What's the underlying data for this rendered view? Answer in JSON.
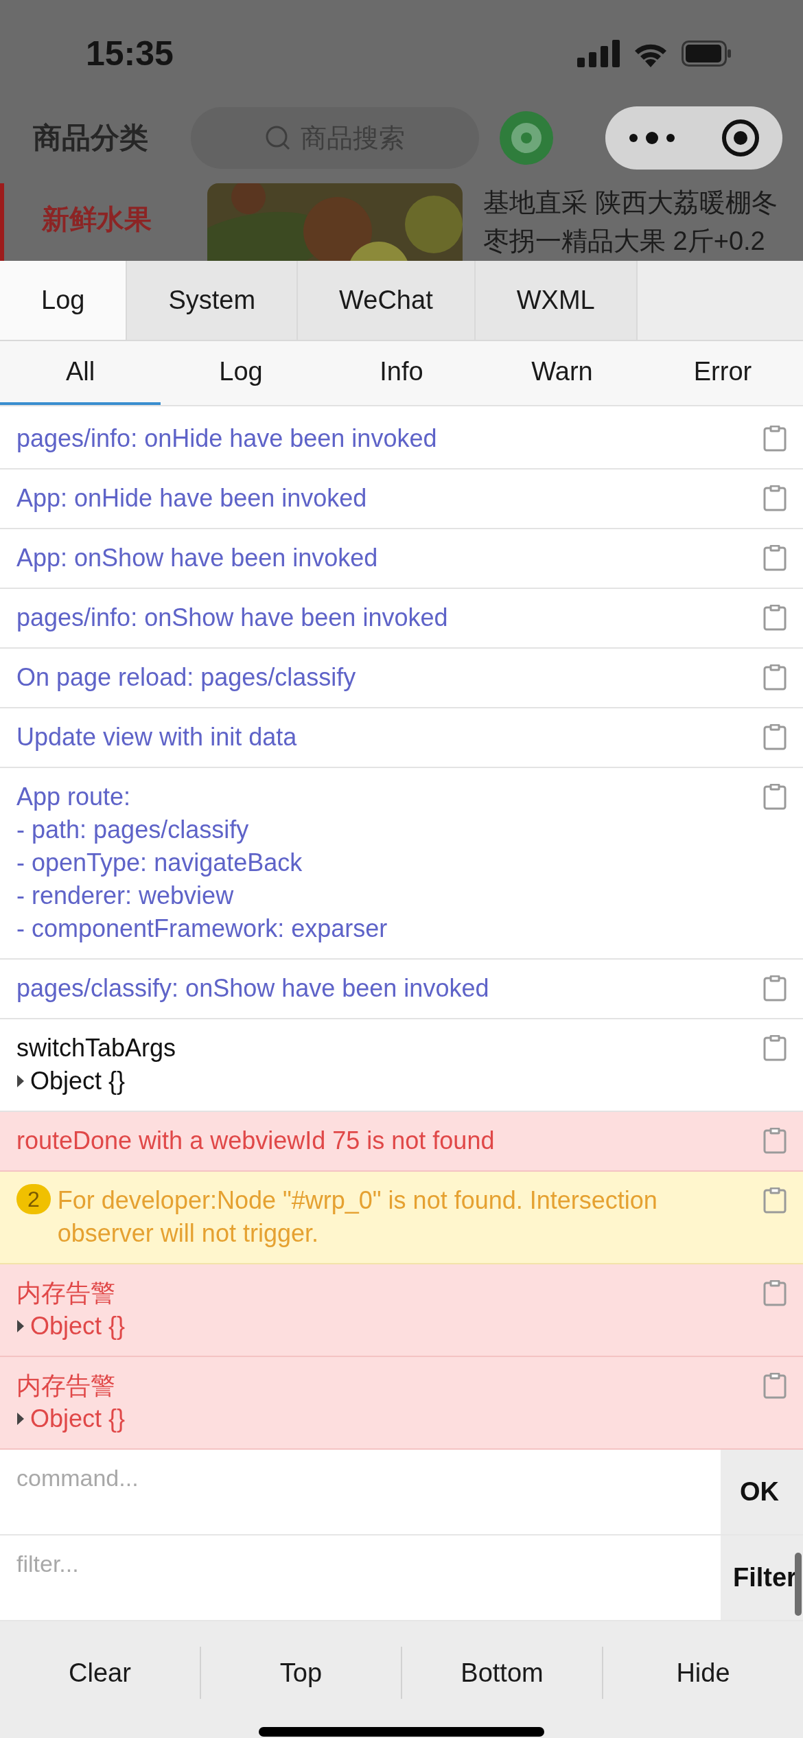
{
  "status_bar": {
    "time": "15:35"
  },
  "nav": {
    "title": "商品分类",
    "search": {
      "placeholder": "商品搜索"
    }
  },
  "category": {
    "label": "新鲜水果",
    "selected": true
  },
  "product": {
    "kind": "picture",
    "title_lines": [
      "基地直采 陕西大荔暖棚冬",
      "枣拐一精品大果 2斤+0.2"
    ]
  },
  "panel_tabs": [
    {
      "label": "Log",
      "selected": true
    },
    {
      "label": "System",
      "selected": false
    },
    {
      "label": "WeChat",
      "selected": false
    },
    {
      "label": "WXML",
      "selected": false
    }
  ],
  "level_tabs": [
    {
      "label": "All",
      "selected": true
    },
    {
      "label": "Log",
      "selected": false
    },
    {
      "label": "Info",
      "selected": false
    },
    {
      "label": "Warn",
      "selected": false
    },
    {
      "label": "Error",
      "selected": false
    }
  ],
  "entries": [
    {
      "kind": "info",
      "lines": [
        {
          "kind": "text",
          "text": "pages/info: onHide have been invoked"
        }
      ]
    },
    {
      "kind": "info",
      "lines": [
        {
          "kind": "text",
          "text": "App: onHide have been invoked"
        }
      ]
    },
    {
      "kind": "info",
      "lines": [
        {
          "kind": "text",
          "text": "App: onShow have been invoked"
        }
      ]
    },
    {
      "kind": "info",
      "lines": [
        {
          "kind": "text",
          "text": "pages/info: onShow have been invoked"
        }
      ]
    },
    {
      "kind": "info",
      "lines": [
        {
          "kind": "text",
          "text": "On page reload: pages/classify"
        }
      ]
    },
    {
      "kind": "info",
      "lines": [
        {
          "kind": "text",
          "text": "Update view with init data"
        }
      ]
    },
    {
      "kind": "info",
      "lines": [
        {
          "kind": "text",
          "text": "App route:"
        },
        {
          "kind": "text",
          "text": "- path: pages/classify"
        },
        {
          "kind": "text",
          "text": "- openType: navigateBack"
        },
        {
          "kind": "text",
          "text": "- renderer: webview"
        },
        {
          "kind": "text",
          "text": "- componentFramework: exparser"
        }
      ]
    },
    {
      "kind": "info",
      "lines": [
        {
          "kind": "text",
          "text": "pages/classify: onShow have been invoked"
        }
      ]
    },
    {
      "kind": "log",
      "lines": [
        {
          "kind": "text",
          "text": "switchTabArgs"
        },
        {
          "kind": "object",
          "text": "Object {}"
        }
      ]
    },
    {
      "kind": "error",
      "lines": [
        {
          "kind": "text",
          "text": "routeDone with a webviewId 75 is not found"
        }
      ]
    },
    {
      "kind": "warn",
      "count": "2",
      "lines": [
        {
          "kind": "text",
          "text": "For developer:Node \"#wrp_0\" is not found. Intersection observer will not trigger."
        }
      ]
    },
    {
      "kind": "error",
      "lines": [
        {
          "kind": "text",
          "text": "内存告警"
        },
        {
          "kind": "object",
          "text": "Object {}"
        }
      ]
    },
    {
      "kind": "error",
      "lines": [
        {
          "kind": "text",
          "text": "内存告警"
        },
        {
          "kind": "object",
          "text": "Object {}"
        }
      ]
    }
  ],
  "command": {
    "placeholder": "command...",
    "button": "OK"
  },
  "filter": {
    "placeholder": "filter...",
    "button": "Filter"
  },
  "actions": [
    "Clear",
    "Top",
    "Bottom",
    "Hide"
  ]
}
